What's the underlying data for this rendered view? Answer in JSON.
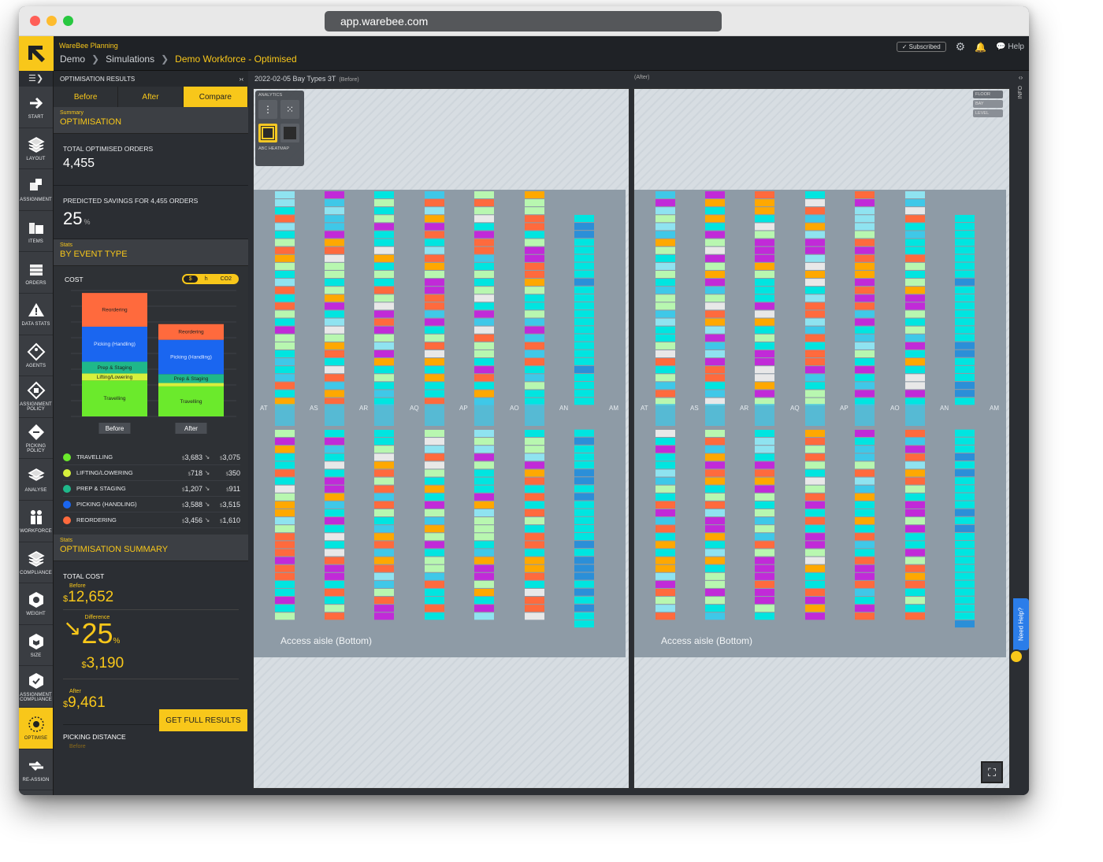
{
  "browser": {
    "url": "app.warebee.com"
  },
  "header": {
    "brand": "WareBee Planning",
    "breadcrumbs": [
      "Demo",
      "Simulations",
      "Demo Workforce - Optimised"
    ],
    "subscribed": "Subscribed",
    "help": "Help"
  },
  "rail": {
    "items": [
      {
        "label": "START",
        "icon": "arrow-right-icon"
      },
      {
        "label": "LAYOUT",
        "icon": "layers-icon"
      },
      {
        "label": "ASSIGNMENT",
        "icon": "boxes-icon"
      },
      {
        "label": "ITEMS",
        "icon": "items-icon"
      },
      {
        "label": "ORDERS",
        "icon": "orders-icon"
      },
      {
        "label": "DATA STATS",
        "icon": "warning-icon"
      },
      {
        "label": "AGENTS",
        "icon": "agent-icon"
      },
      {
        "label": "ASSIGNMENT POLICY",
        "icon": "policy-icon"
      },
      {
        "label": "PICKING POLICY",
        "icon": "picking-icon"
      },
      {
        "label": "ANALYSE",
        "icon": "analyse-icon"
      },
      {
        "label": "WORKFORCE",
        "icon": "workforce-icon"
      },
      {
        "label": "COMPLIANCE",
        "icon": "compliance-icon"
      },
      {
        "label": "WEIGHT",
        "icon": "weight-icon"
      },
      {
        "label": "SIZE",
        "icon": "size-icon"
      },
      {
        "label": "ASSIGNMENT COMPLIANCE",
        "icon": "assignment-compliance-icon"
      },
      {
        "label": "OPTIMISE",
        "icon": "optimise-icon"
      },
      {
        "label": "RE-ASSIGN",
        "icon": "reassign-icon"
      }
    ]
  },
  "panel": {
    "title": "OPTIMISATION RESULTS",
    "tabs": [
      "Before",
      "After",
      "Compare"
    ],
    "summary": {
      "sub": "Summary",
      "title": "OPTIMISATION"
    },
    "total_orders_label": "TOTAL OPTIMISED ORDERS",
    "total_orders_value": "4,455",
    "savings_label": "PREDICTED SAVINGS FOR 4,455 ORDERS",
    "savings_value": "25",
    "savings_unit": "%",
    "stats": {
      "sub": "Stats",
      "title": "BY EVENT TYPE"
    },
    "cost_label": "COST",
    "cost_toggle": [
      "$",
      "h",
      "CO2"
    ],
    "legend": [
      {
        "name": "TRAVELLING",
        "color": "#6bea2c",
        "before": "3,683",
        "after": "3,075"
      },
      {
        "name": "LIFTING/LOWERING",
        "color": "#d6f03c",
        "before": "718",
        "after": "350"
      },
      {
        "name": "PREP & STAGING",
        "color": "#1fb88a",
        "before": "1,207",
        "after": "911"
      },
      {
        "name": "PICKING (HANDLING)",
        "color": "#1a66f0",
        "before": "3,588",
        "after": "3,515"
      },
      {
        "name": "REORDERING",
        "color": "#ff6a3d",
        "before": "3,456",
        "after": "1,610"
      }
    ],
    "currency": "$",
    "arrow": "↘",
    "summary2": {
      "sub": "Stats",
      "title": "OPTIMISATION SUMMARY"
    },
    "total_cost_label": "TOTAL COST",
    "before_label": "Before",
    "before_value": "12,652",
    "difference_label": "Difference",
    "difference_pct": "25",
    "difference_value": "3,190",
    "after_label": "After",
    "after_value": "9,461",
    "picking_distance_label": "PICKING DISTANCE",
    "picking_before_label": "Before",
    "full_results_button": "GET FULL RESULTS"
  },
  "chart_data": {
    "type": "bar",
    "categories": [
      "Before",
      "After"
    ],
    "series": [
      {
        "name": "Travelling",
        "color": "#6bea2c",
        "values": [
          3683,
          3075
        ]
      },
      {
        "name": "Lifting/Lowering",
        "color": "#d6f03c",
        "values": [
          718,
          350
        ]
      },
      {
        "name": "Prep & Staging",
        "color": "#1fb88a",
        "values": [
          1207,
          911
        ]
      },
      {
        "name": "Picking (Handling)",
        "color": "#1a66f0",
        "values": [
          3588,
          3515
        ]
      },
      {
        "name": "Reordering",
        "color": "#ff6a3d",
        "values": [
          3456,
          1610
        ]
      }
    ],
    "stacked": true
  },
  "view_header": {
    "left_title": "2022-02-05 Bay Types 3T",
    "left_tag": "(Before)",
    "right_tag": "(After)"
  },
  "views": {
    "analytics_label": "ANALYTICS",
    "heatmap_label": "ABC HEATMAP",
    "floor": "FLOOR",
    "bay": "BAY",
    "level": "LEVEL",
    "aisles": [
      "AT",
      "AS",
      "AR",
      "AQ",
      "AP",
      "AO",
      "AN",
      "AM"
    ],
    "access_aisle": "Access aisle (Bottom)",
    "palette": [
      "#00e5e0",
      "#b8f7b0",
      "#ff6a3d",
      "#ffa800",
      "#c12ad8",
      "#3fc8e8",
      "#8fe3f0",
      "#e8e8e8",
      "#2b8fd8"
    ]
  },
  "right_rail": {
    "info": "INFO",
    "need_help": "Need Help?"
  }
}
